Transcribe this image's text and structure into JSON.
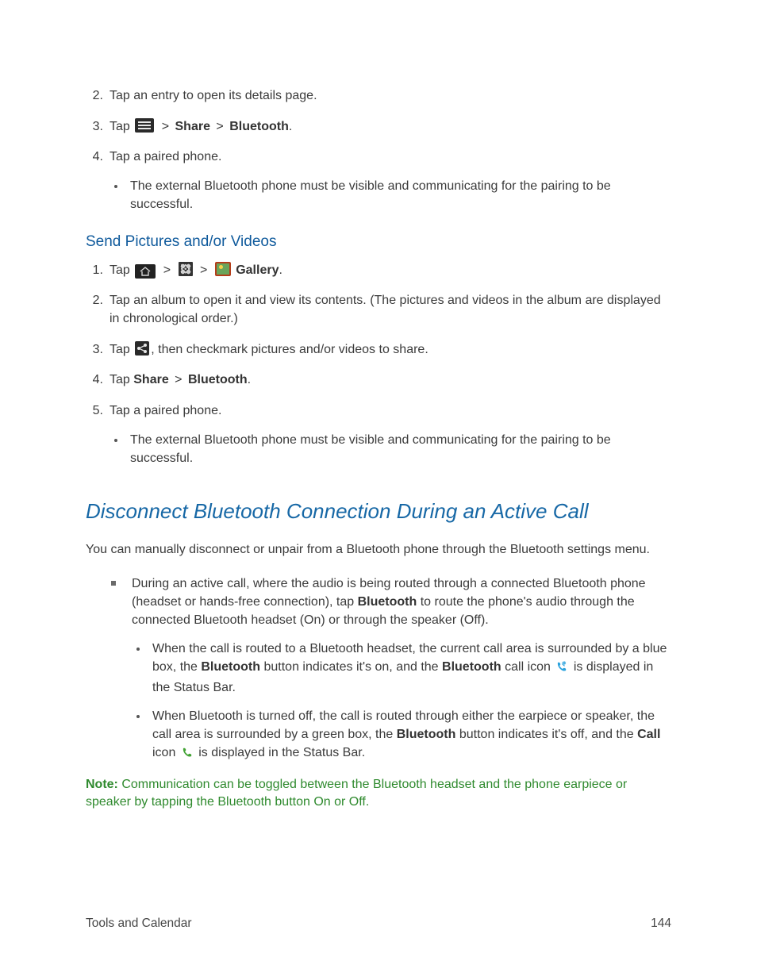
{
  "list1": {
    "item2": {
      "num": "2.",
      "text": "Tap an entry to open its details page."
    },
    "item3": {
      "num": "3.",
      "tap": "Tap",
      "share": "Share",
      "bluetooth": "Bluetooth",
      "dot": "."
    },
    "item4": {
      "num": "4.",
      "text": "Tap a paired phone.",
      "sub1": "The external Bluetooth phone must be visible and communicating for the pairing to be successful."
    }
  },
  "subA": {
    "title": "Send Pictures and/or Videos"
  },
  "list2": {
    "item1": {
      "num": "1.",
      "tap": "Tap",
      "gallery": "Gallery",
      "dot": "."
    },
    "item2": {
      "num": "2.",
      "text": "Tap an album to open it and view its contents. (The pictures and videos in the album are displayed in chronological order.)"
    },
    "item3": {
      "num": "3.",
      "tap": "Tap",
      "text_after": ", then checkmark pictures and/or videos to share."
    },
    "item4": {
      "num": "4.",
      "tap": "Tap ",
      "share": "Share",
      "bluetooth": "Bluetooth",
      "dot": "."
    },
    "item5": {
      "num": "5.",
      "text": "Tap a paired phone.",
      "sub1": "The external Bluetooth phone must be visible and communicating for the pairing to be successful."
    }
  },
  "section": {
    "title": "Disconnect Bluetooth Connection During an Active Call",
    "intro": "You can manually disconnect or unpair from a Bluetooth phone through the Bluetooth settings menu.",
    "sq1a": "During an active call, where the audio is being routed through a connected Bluetooth phone (headset or hands-free connection), tap ",
    "sq1b": "Bluetooth",
    "sq1c": " to route the phone's audio through the connected Bluetooth headset (On) or through the speaker (Off).",
    "bul1a": "When the call is routed to a Bluetooth headset, the current call area is surrounded by a blue box, the ",
    "bul1b": "Bluetooth",
    "bul1c": " button indicates it's on, and the ",
    "bul1d": "Bluetooth",
    "bul1e": " call icon ",
    "bul1f": " is displayed in the Status Bar.",
    "bul2a": "When Bluetooth is turned off, the call is routed through either the earpiece or speaker, the call area is surrounded by a green box, the ",
    "bul2b": "Bluetooth",
    "bul2c": " button indicates it's off, and the ",
    "bul2d": "Call",
    "bul2e": " icon ",
    "bul2f": " is displayed in the Status Bar."
  },
  "note": {
    "label": "Note:",
    "text": "  Communication can be toggled between the Bluetooth headset and the phone earpiece or speaker by tapping the Bluetooth button On or Off."
  },
  "footer": {
    "section": "Tools and Calendar",
    "page": "144"
  },
  "glyph": {
    "gt": ">"
  }
}
